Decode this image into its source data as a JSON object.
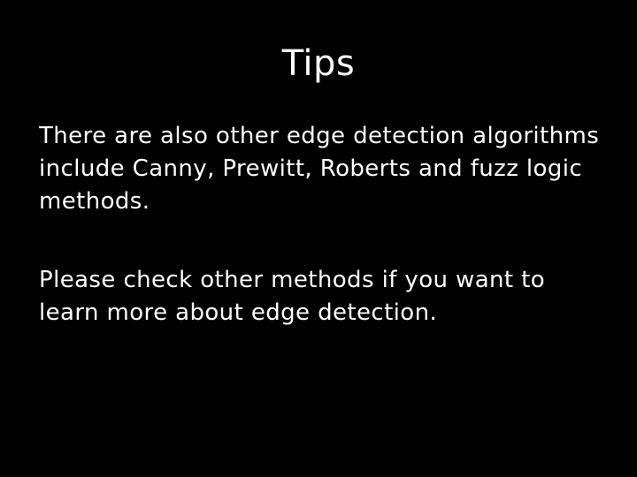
{
  "slide": {
    "title": "Tips",
    "paragraphs": [
      "There are also other edge detection algorithms include Canny, Prewitt, Roberts and fuzz logic methods.",
      "Please check other methods if you want to learn more about edge detection."
    ]
  },
  "colors": {
    "background": "#000000",
    "text": "#ffffff"
  }
}
